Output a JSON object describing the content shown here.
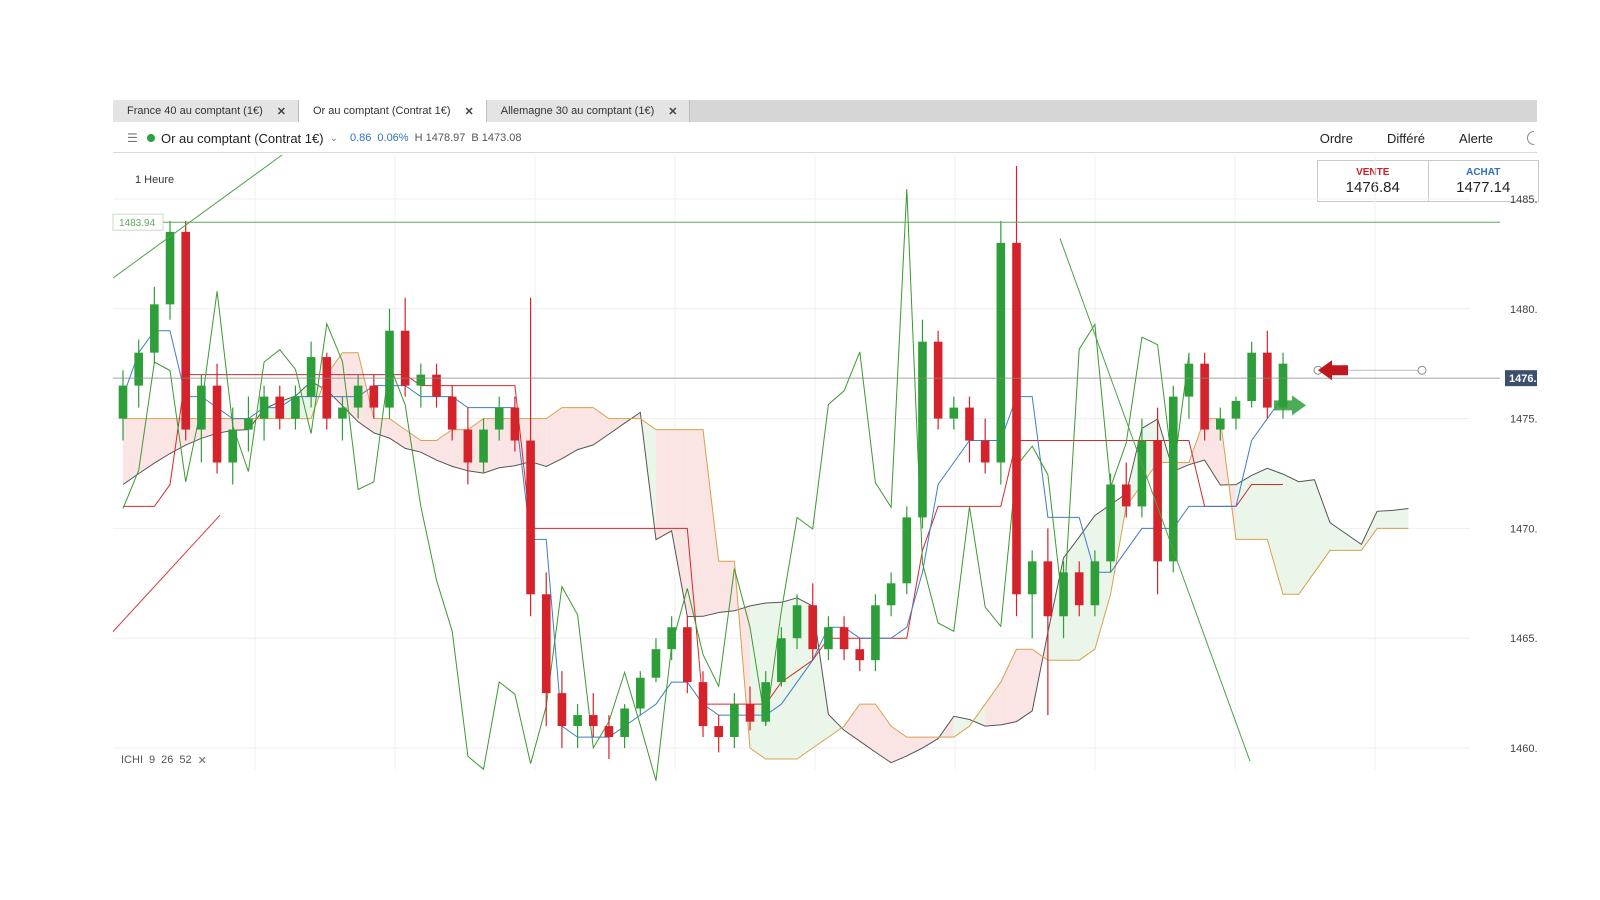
{
  "tabs": [
    {
      "label": "France 40 au comptant (1€)",
      "close": "✕",
      "active": false
    },
    {
      "label": "Or au comptant (Contrat 1€)",
      "close": "✕",
      "active": true
    },
    {
      "label": "Allemagne 30 au comptant (1€)",
      "close": "✕",
      "active": false
    }
  ],
  "toolbar": {
    "instrument": "Or au comptant (Contrat 1€)",
    "change": "0.86",
    "change_pct": "0.06%",
    "high": "H 1478.97",
    "low": "B 1473.08",
    "actions": [
      "Ordre",
      "Différé",
      "Alerte"
    ]
  },
  "trade": {
    "sell_label": "VENTE",
    "sell_price": "1476.84",
    "buy_label": "ACHAT",
    "buy_price": "1477.14",
    "sell_color": "#d0202a",
    "buy_color": "#2f6fbf"
  },
  "interval": "1 Heure",
  "indicator": {
    "name": "ICHI",
    "p1": "9",
    "p2": "26",
    "p3": "52",
    "remove": "✕"
  },
  "price_axis": {
    "ticks": [
      "1485.",
      "1480.",
      "1475.",
      "1470.",
      "1465.",
      "1460."
    ],
    "current_label": "1476.",
    "level_label": "1483.94"
  },
  "colors": {
    "bull": "#2e9e3a",
    "bear": "#d4232b",
    "tenkan": "#d42a2a",
    "kijun": "#3f7cc9",
    "chikou": "#3a9a2e",
    "span_a": "#555555",
    "span_b": "#d8a04c",
    "cloud_bull": "#eaf6ea",
    "cloud_bear": "#fbe4e4"
  },
  "chart_data": {
    "type": "candlestick",
    "instrument": "Or au comptant (Contrat 1€)",
    "interval": "1 Heure",
    "ylim": [
      1459,
      1487
    ],
    "y_ticks": [
      1460,
      1465,
      1470,
      1475,
      1480,
      1485
    ],
    "horizontal_level": 1483.94,
    "current_price": 1476.84,
    "ohlc": [
      [
        1475.0,
        1477.2,
        1474.0,
        1476.5
      ],
      [
        1476.5,
        1478.6,
        1475.5,
        1478.0
      ],
      [
        1478.0,
        1481.0,
        1477.5,
        1480.2
      ],
      [
        1480.2,
        1484.0,
        1479.5,
        1483.5
      ],
      [
        1483.5,
        1484.0,
        1474.0,
        1474.5
      ],
      [
        1474.5,
        1477.0,
        1473.0,
        1476.5
      ],
      [
        1476.5,
        1477.5,
        1472.5,
        1473.0
      ],
      [
        1473.0,
        1475.5,
        1472.0,
        1474.5
      ],
      [
        1474.5,
        1476.0,
        1473.5,
        1475.0
      ],
      [
        1475.0,
        1476.5,
        1474.0,
        1476.0
      ],
      [
        1476.0,
        1476.5,
        1474.5,
        1475.0
      ],
      [
        1475.0,
        1476.5,
        1474.5,
        1476.0
      ],
      [
        1476.0,
        1478.5,
        1475.5,
        1477.8
      ],
      [
        1477.8,
        1478.0,
        1474.5,
        1475.0
      ],
      [
        1475.0,
        1476.0,
        1474.0,
        1475.5
      ],
      [
        1475.5,
        1477.0,
        1475.0,
        1476.5
      ],
      [
        1476.5,
        1477.0,
        1475.0,
        1475.5
      ],
      [
        1475.5,
        1480.0,
        1475.0,
        1479.0
      ],
      [
        1479.0,
        1480.5,
        1476.0,
        1476.5
      ],
      [
        1476.5,
        1477.5,
        1475.5,
        1477.0
      ],
      [
        1477.0,
        1477.5,
        1475.5,
        1476.0
      ],
      [
        1476.0,
        1476.5,
        1474.0,
        1474.5
      ],
      [
        1474.5,
        1475.5,
        1472.0,
        1473.0
      ],
      [
        1473.0,
        1475.0,
        1472.5,
        1474.5
      ],
      [
        1474.5,
        1476.0,
        1474.0,
        1475.5
      ],
      [
        1475.5,
        1476.0,
        1473.5,
        1474.0
      ],
      [
        1474.0,
        1480.5,
        1466.0,
        1467.0
      ],
      [
        1467.0,
        1468.0,
        1461.0,
        1462.5
      ],
      [
        1462.5,
        1463.5,
        1460.0,
        1461.0
      ],
      [
        1461.0,
        1462.0,
        1460.0,
        1461.5
      ],
      [
        1461.5,
        1462.5,
        1460.5,
        1461.0
      ],
      [
        1461.0,
        1461.5,
        1459.5,
        1460.5
      ],
      [
        1460.5,
        1462.0,
        1460.0,
        1461.8
      ],
      [
        1461.8,
        1463.5,
        1461.5,
        1463.2
      ],
      [
        1463.2,
        1465.0,
        1463.0,
        1464.5
      ],
      [
        1464.5,
        1466.0,
        1464.0,
        1465.5
      ],
      [
        1465.5,
        1466.0,
        1462.5,
        1463.0
      ],
      [
        1463.0,
        1463.5,
        1460.5,
        1461.0
      ],
      [
        1461.0,
        1461.5,
        1459.8,
        1460.5
      ],
      [
        1460.5,
        1462.5,
        1460.0,
        1462.0
      ],
      [
        1462.0,
        1462.8,
        1460.8,
        1461.2
      ],
      [
        1461.2,
        1463.5,
        1461.0,
        1463.0
      ],
      [
        1463.0,
        1465.5,
        1462.8,
        1465.0
      ],
      [
        1465.0,
        1467.0,
        1464.5,
        1466.5
      ],
      [
        1466.5,
        1467.5,
        1464.0,
        1464.5
      ],
      [
        1464.5,
        1466.0,
        1464.0,
        1465.5
      ],
      [
        1465.5,
        1466.0,
        1464.0,
        1464.5
      ],
      [
        1464.5,
        1465.0,
        1463.5,
        1464.0
      ],
      [
        1464.0,
        1467.0,
        1463.5,
        1466.5
      ],
      [
        1466.5,
        1468.0,
        1466.0,
        1467.5
      ],
      [
        1467.5,
        1471.0,
        1467.0,
        1470.5
      ],
      [
        1470.5,
        1479.5,
        1470.0,
        1478.5
      ],
      [
        1478.5,
        1479.0,
        1474.5,
        1475.0
      ],
      [
        1475.0,
        1476.0,
        1474.5,
        1475.5
      ],
      [
        1475.5,
        1476.0,
        1473.0,
        1474.0
      ],
      [
        1474.0,
        1475.0,
        1472.5,
        1473.0
      ],
      [
        1473.0,
        1484.0,
        1472.0,
        1483.0
      ],
      [
        1483.0,
        1486.5,
        1466.0,
        1467.0
      ],
      [
        1467.0,
        1469.0,
        1465.0,
        1468.5
      ],
      [
        1468.5,
        1470.0,
        1461.5,
        1466.0
      ],
      [
        1466.0,
        1468.5,
        1465.0,
        1468.0
      ],
      [
        1468.0,
        1468.5,
        1466.0,
        1466.5
      ],
      [
        1466.5,
        1469.0,
        1466.0,
        1468.5
      ],
      [
        1468.5,
        1472.5,
        1468.0,
        1472.0
      ],
      [
        1472.0,
        1473.0,
        1470.5,
        1471.0
      ],
      [
        1471.0,
        1475.0,
        1470.5,
        1474.0
      ],
      [
        1474.0,
        1475.5,
        1467.0,
        1468.5
      ],
      [
        1468.5,
        1476.5,
        1468.0,
        1476.0
      ],
      [
        1476.0,
        1478.0,
        1475.0,
        1477.5
      ],
      [
        1477.5,
        1478.0,
        1474.0,
        1474.5
      ],
      [
        1474.5,
        1475.5,
        1474.0,
        1475.0
      ],
      [
        1475.0,
        1476.0,
        1474.5,
        1475.8
      ],
      [
        1475.8,
        1478.5,
        1475.5,
        1478.0
      ],
      [
        1478.0,
        1479.0,
        1475.0,
        1475.5
      ],
      [
        1475.5,
        1478.0,
        1475.0,
        1477.5
      ]
    ],
    "series": [
      {
        "name": "Tenkan",
        "values": [
          1471,
          1471,
          1471,
          1472,
          1477,
          1477,
          1477,
          1477,
          1477,
          1477,
          1477,
          1477,
          1477,
          1477,
          1477,
          1477,
          1477,
          1477,
          1477,
          1476.5,
          1476.5,
          1476.5,
          1476.5,
          1476.5,
          1476.5,
          1476.5,
          1470,
          1470,
          1470,
          1470,
          1470,
          1470,
          1470,
          1470,
          1470,
          1470,
          1470,
          1462,
          1462,
          1462,
          1462,
          1462,
          1463,
          1463.5,
          1464,
          1465,
          1465,
          1465,
          1465,
          1465,
          1465,
          1469,
          1471,
          1471,
          1471,
          1471,
          1471,
          1474,
          1474,
          1474,
          1474,
          1474,
          1474,
          1474,
          1474,
          1474,
          1474,
          1474,
          1474,
          1471,
          1471,
          1471,
          1472,
          1472,
          1472
        ]
      },
      {
        "name": "Kijun",
        "values": [
          1476,
          1478,
          1479,
          1479,
          1476,
          1476,
          1475.5,
          1475,
          1475,
          1475.5,
          1475.5,
          1476,
          1476,
          1476,
          1476,
          1476,
          1476.5,
          1476.5,
          1476.5,
          1476,
          1476,
          1476,
          1475.5,
          1475.5,
          1475.5,
          1475.5,
          1469.5,
          1469.5,
          1461,
          1460.5,
          1460.5,
          1460.5,
          1461,
          1461.5,
          1462,
          1463,
          1463,
          1462,
          1461.5,
          1461.5,
          1461.5,
          1461.5,
          1462,
          1463,
          1464,
          1465.5,
          1465.5,
          1465,
          1465,
          1465,
          1465.5,
          1468,
          1472,
          1473,
          1474,
          1474,
          1474,
          1476,
          1476,
          1470.5,
          1470.5,
          1470.5,
          1468,
          1468,
          1469,
          1470,
          1470,
          1470,
          1471,
          1471,
          1471,
          1471,
          1474,
          1475,
          1476
        ]
      }
    ]
  }
}
